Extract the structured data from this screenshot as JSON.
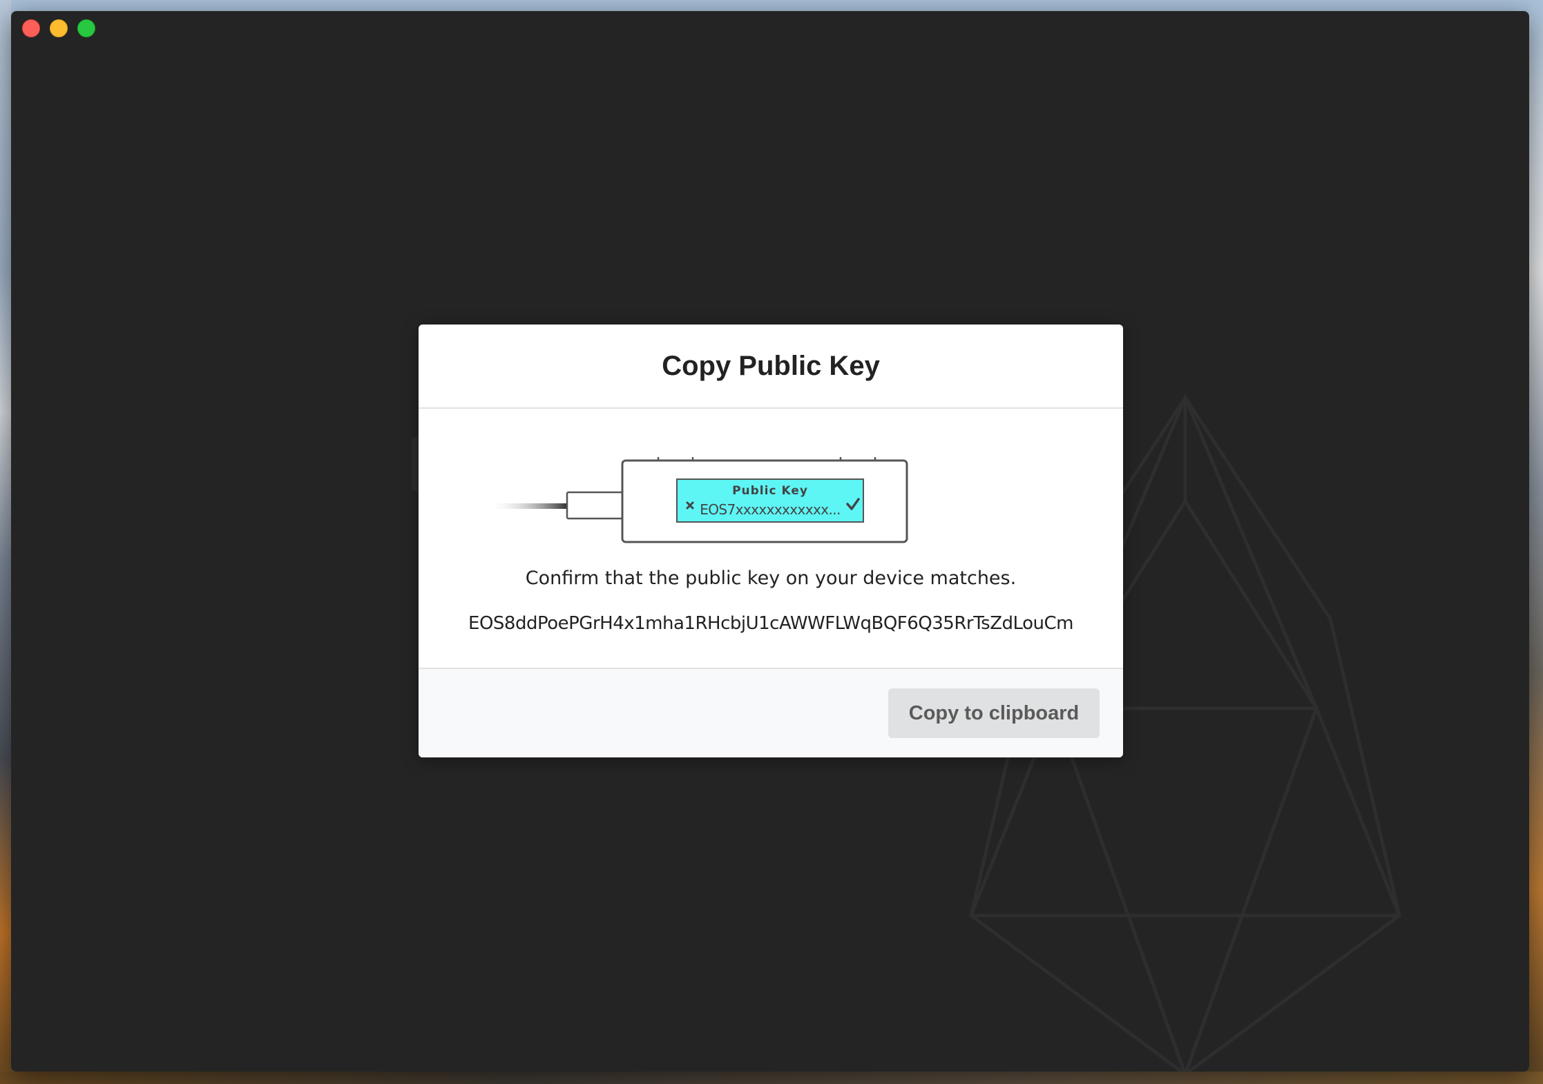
{
  "window": {
    "controls": [
      "close",
      "minimize",
      "zoom"
    ],
    "background_color": "#242424"
  },
  "modal": {
    "title": "Copy Public Key",
    "device_illustration": {
      "screen_title": "Public Key",
      "screen_value": "EOS7xxxxxxxxxxxx...",
      "left_icon": "cross-icon",
      "right_icon": "check-icon",
      "screen_color": "#5ef5f5"
    },
    "confirm_text": "Confirm that the public key on your device matches.",
    "public_key": "EOS8ddPoePGrH4x1mha1RHcbjU1cAWWFLWqBQF6Q35RrTsZdLouCm",
    "copy_button_label": "Copy to clipboard"
  }
}
